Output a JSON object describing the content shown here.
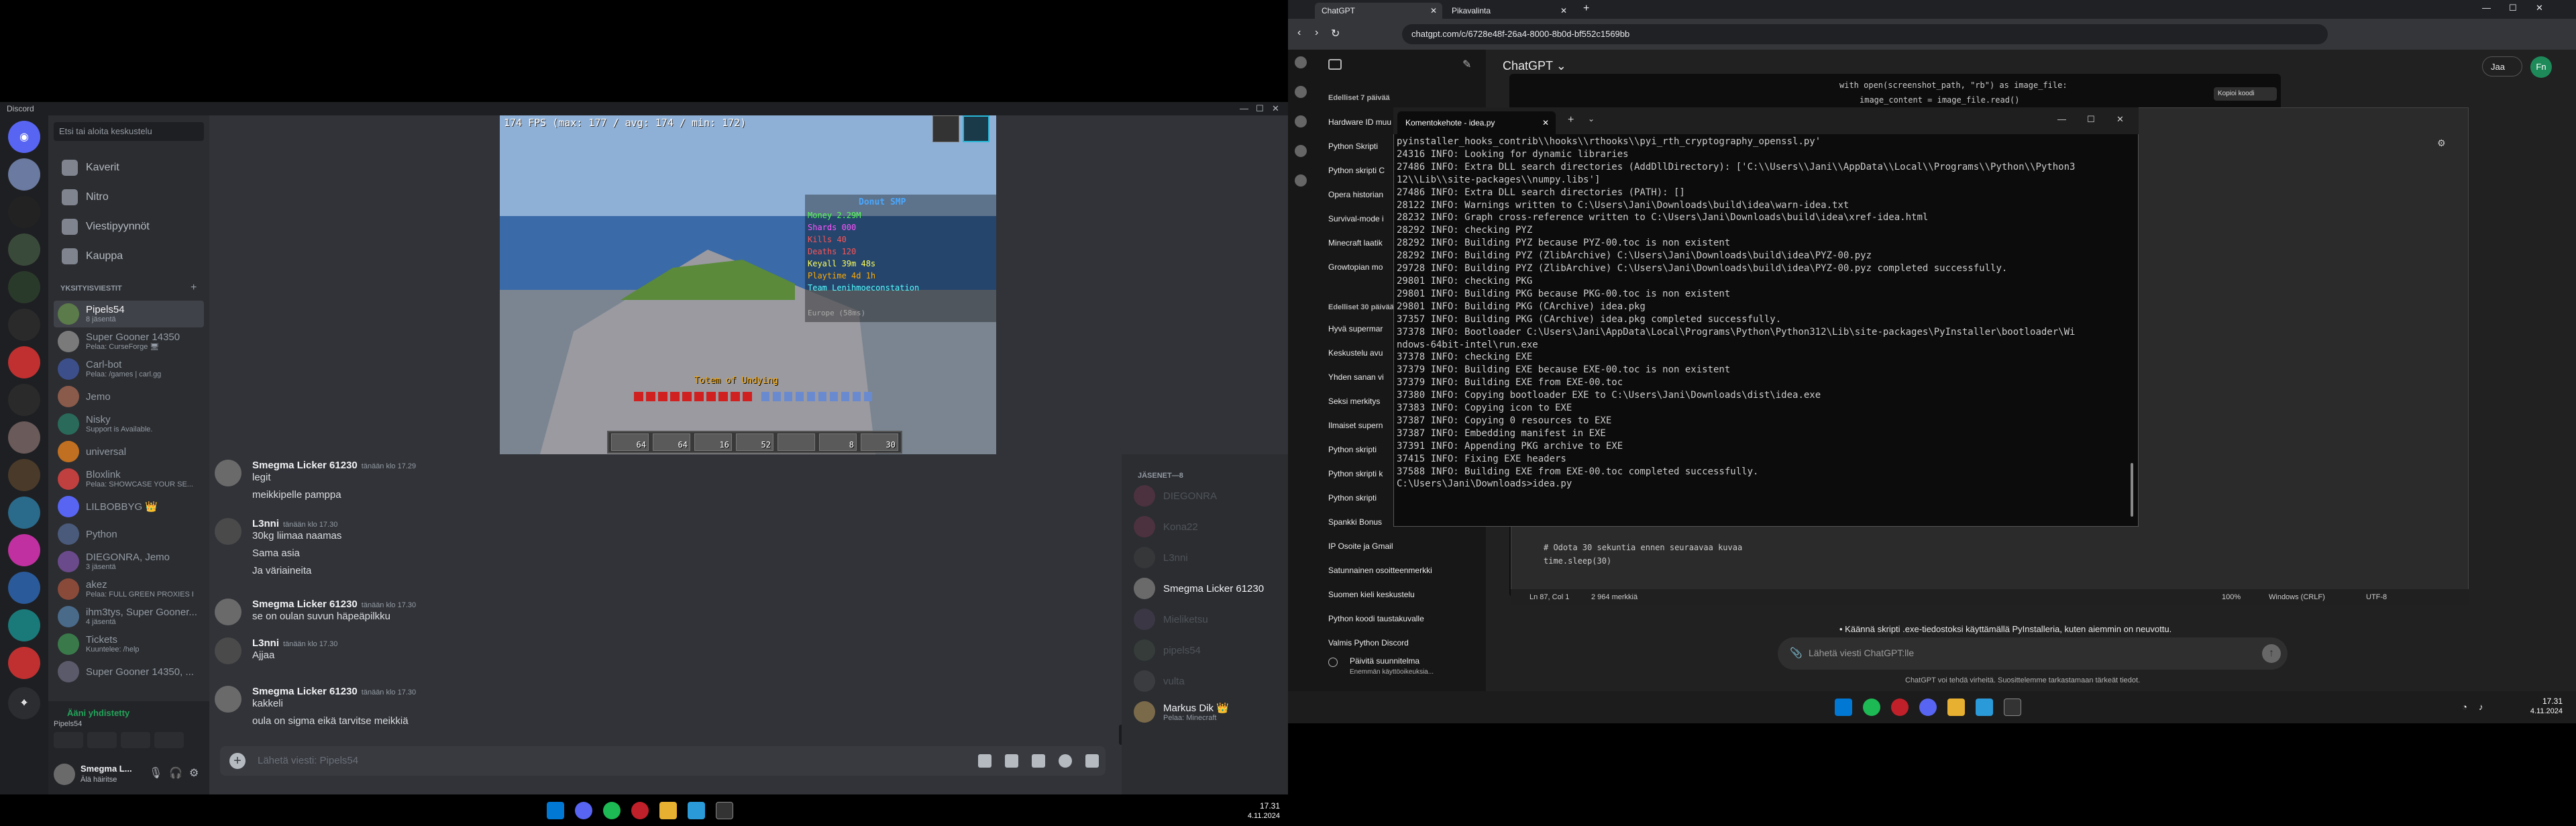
{
  "discord": {
    "title": "Discord",
    "search_placeholder": "Etsi tai aloita keskustelu",
    "nav": [
      "Kaverit",
      "Nitro",
      "Viestipyynnöt",
      "Kauppa"
    ],
    "dm_header": "YKSITYISVIESTIT",
    "dms": [
      {
        "name": "Pipels54",
        "sub": "8 jäsentä",
        "color": "#5b7b4a"
      },
      {
        "name": "Super Gooner 14350",
        "sub": "Pelaa: CurseForge 🖥",
        "color": "#7a7a7a"
      },
      {
        "name": "Carl-bot",
        "sub": "Pelaa: /games | carl.gg",
        "color": "#3d4f8a"
      },
      {
        "name": "Jemo",
        "sub": "",
        "color": "#8a5a4a"
      },
      {
        "name": "Nisky",
        "sub": "Support is Available.",
        "color": "#2a6a5a"
      },
      {
        "name": "universal",
        "sub": "",
        "color": "#c07020"
      },
      {
        "name": "Bloxlink",
        "sub": "Pelaa: SHOWCASE YOUR SE...",
        "color": "#c04040"
      },
      {
        "name": "LILBOBBYG 👑",
        "sub": "",
        "color": "#5865f2"
      },
      {
        "name": "Python",
        "sub": "",
        "color": "#4a5a7a"
      },
      {
        "name": "DIEGONRA, Jemo",
        "sub": "3 jäsentä",
        "color": "#6a4a8a"
      },
      {
        "name": "akez",
        "sub": "Pelaa: FULL GREEN PROXIES BO",
        "color": "#8a4a3a"
      },
      {
        "name": "ihm3tys, Super Gooner...",
        "sub": "4 jäsentä",
        "color": "#4a6a8a"
      },
      {
        "name": "Tickets",
        "sub": "Kuuntelee: /help",
        "color": "#3a7a4a"
      },
      {
        "name": "Super Gooner 14350, ...",
        "sub": "",
        "color": "#5a5a6a"
      }
    ],
    "voice_status": "Ääni yhdistetty",
    "voice_channel": "Pipels54",
    "user_name": "Smegma L...",
    "user_status": "Älä häiritse",
    "messages": [
      {
        "author": "Smegma Licker 61230",
        "time": "tänään klo 17.29",
        "lines": [
          "legit",
          "meikkipelle pamppa"
        ],
        "color": "#6a6a6a"
      },
      {
        "author": "L3nni",
        "time": "tänään klo 17.30",
        "lines": [
          "30kg liimaa naamas",
          "Sama asia",
          "Ja väriaineita"
        ],
        "color": "#4a4a4a"
      },
      {
        "author": "Smegma Licker 61230",
        "time": "tänään klo 17.30",
        "lines": [
          "se on oulan suvun häpeäpilkku"
        ],
        "color": "#6a6a6a"
      },
      {
        "author": "L3nni",
        "time": "tänään klo 17.30",
        "lines": [
          "Ajjaa"
        ],
        "color": "#4a4a4a"
      },
      {
        "author": "Smegma Licker 61230",
        "time": "tänään klo 17.30",
        "lines": [
          "kakkeli",
          "oula on sigma eikä tarvitse meikkiä"
        ],
        "color": "#6a6a6a"
      }
    ],
    "input_placeholder": "Lähetä viesti: Pipels54",
    "members_header": "JÄSENET—8",
    "members": [
      {
        "name": "DIEGONRA",
        "color": "#8a3a5a",
        "dim": true
      },
      {
        "name": "Kona22",
        "color": "#8a3a5a",
        "dim": true
      },
      {
        "name": "L3nni",
        "color": "#4a4a4a",
        "dim": true
      },
      {
        "name": "Smegma Licker 61230",
        "color": "#6a6a6a",
        "dim": false
      },
      {
        "name": "Mieliketsu",
        "color": "#5a4a6a",
        "dim": true
      },
      {
        "name": "pipels54",
        "color": "#4a5a4a",
        "dim": true
      },
      {
        "name": "vulta",
        "color": "#5a5a5a",
        "dim": true
      },
      {
        "name": "Markus Dik 👑",
        "color": "#7a6a4a",
        "dim": false,
        "sub": "Pelaa: Minecraft"
      }
    ],
    "stream": {
      "fps": "174 FPS (max: 177 / avg: 174 / min: 172)",
      "sb_title": "Donut SMP",
      "sb_lines": [
        "Money 2.29M",
        "Shards 000",
        "Kills 40",
        "Deaths 120",
        "Keyall 39m 48s",
        "Playtime 4d 1h",
        "Team Lenihmoeconstation"
      ],
      "sb_footer": "Europe (58ms)",
      "item_name": "Totem of Undying",
      "hotbar_counts": [
        "64",
        "64",
        "16",
        "52",
        "",
        "8",
        "30"
      ]
    }
  },
  "taskbar_left": {
    "time": "17.31",
    "date": "4.11.2024"
  },
  "browser": {
    "tabs": [
      "ChatGPT",
      "Pikavalinta"
    ],
    "url": "chatgpt.com/c/6728e48f-26a4-8000-8b0d-bf552c1569bb",
    "model": "ChatGPT",
    "share": "Jaa",
    "avatar": "Fn",
    "copy_code": "Kopioi koodi",
    "history_group1": "Edelliset 7 päivää",
    "history1": [
      "Hardware ID muu",
      "Python Skripti",
      "Python skripti C",
      "Opera historian",
      "Survival-mode i",
      "Minecraft laatik",
      "Growtopian mo"
    ],
    "history_group2": "Edelliset 30 päivää",
    "history2": [
      "Hyvä supermar",
      "Keskustelu avu",
      "Yhden sanan vi",
      "Seksi merkitys",
      "Ilmaiset supern",
      "Python skripti",
      "Python skripti k",
      "Python skripti",
      "Spankki Bonus",
      "IP Osoite ja Gmail",
      "Satunnainen osoitteenmerkki",
      "Suomen kieli keskustelu",
      "Python koodi taustakuvalle",
      "Valmis Python Discord"
    ],
    "upgrade_title": "Päivitä suunnitelma",
    "upgrade_sub": "Enemmän käyttöoikeuksia...",
    "code_top_1": "with open(screenshot_path, \"rb\") as image_file:",
    "code_top_2": "image_content = image_file.read()",
    "code_bottom_1": "# Odota 30 sekuntia ennen seuraavaa kuvaa",
    "code_bottom_2": "time.sleep(30)",
    "bullet": "Käännä skripti .exe-tiedostoksi käyttämällä PyInstalleria, kuten aiemmin on neuvottu.",
    "input_placeholder": "Lähetä viesti ChatGPT:lle",
    "disclaimer": "ChatGPT voi tehdä virheitä. Suosittelemme tarkastamaan tärkeät tiedot."
  },
  "notepad_status": {
    "pos": "Ln 87, Col 1",
    "chars": "2 964 merkkiä",
    "zoom": "100%",
    "eol": "Windows (CRLF)",
    "enc": "UTF-8"
  },
  "terminal": {
    "tab": "Komentokehote - idea.py",
    "lines": [
      "pyinstaller_hooks_contrib\\\\hooks\\\\rthooks\\\\pyi_rth_cryptography_openssl.py'",
      "24316 INFO: Looking for dynamic libraries",
      "27486 INFO: Extra DLL search directories (AddDllDirectory): ['C:\\\\Users\\\\Jani\\\\AppData\\\\Local\\\\Programs\\\\Python\\\\Python3",
      "12\\\\Lib\\\\site-packages\\\\numpy.libs']",
      "27486 INFO: Extra DLL search directories (PATH): []",
      "28122 INFO: Warnings written to C:\\Users\\Jani\\Downloads\\build\\idea\\warn-idea.txt",
      "28232 INFO: Graph cross-reference written to C:\\Users\\Jani\\Downloads\\build\\idea\\xref-idea.html",
      "28292 INFO: checking PYZ",
      "28292 INFO: Building PYZ because PYZ-00.toc is non existent",
      "28292 INFO: Building PYZ (ZlibArchive) C:\\Users\\Jani\\Downloads\\build\\idea\\PYZ-00.pyz",
      "29728 INFO: Building PYZ (ZlibArchive) C:\\Users\\Jani\\Downloads\\build\\idea\\PYZ-00.pyz completed successfully.",
      "29801 INFO: checking PKG",
      "29801 INFO: Building PKG because PKG-00.toc is non existent",
      "29801 INFO: Building PKG (CArchive) idea.pkg",
      "37357 INFO: Building PKG (CArchive) idea.pkg completed successfully.",
      "37378 INFO: Bootloader C:\\Users\\Jani\\AppData\\Local\\Programs\\Python\\Python312\\Lib\\site-packages\\PyInstaller\\bootloader\\Wi",
      "ndows-64bit-intel\\run.exe",
      "37378 INFO: checking EXE",
      "37379 INFO: Building EXE because EXE-00.toc is non existent",
      "37379 INFO: Building EXE from EXE-00.toc",
      "37380 INFO: Copying bootloader EXE to C:\\Users\\Jani\\Downloads\\dist\\idea.exe",
      "37383 INFO: Copying icon to EXE",
      "37387 INFO: Copying 0 resources to EXE",
      "37387 INFO: Embedding manifest in EXE",
      "37391 INFO: Appending PKG archive to EXE",
      "37415 INFO: Fixing EXE headers",
      "37588 INFO: Building EXE from EXE-00.toc completed successfully.",
      "",
      "C:\\Users\\Jani\\Downloads>idea.py"
    ]
  },
  "taskbar_right": {
    "time": "17.31",
    "date": "4.11.2024"
  },
  "colors": {
    "discord_bg": "#313338",
    "accent": "#5865f2",
    "terminal_bg": "#0c0c0c",
    "chatgpt_bg": "#212121"
  }
}
